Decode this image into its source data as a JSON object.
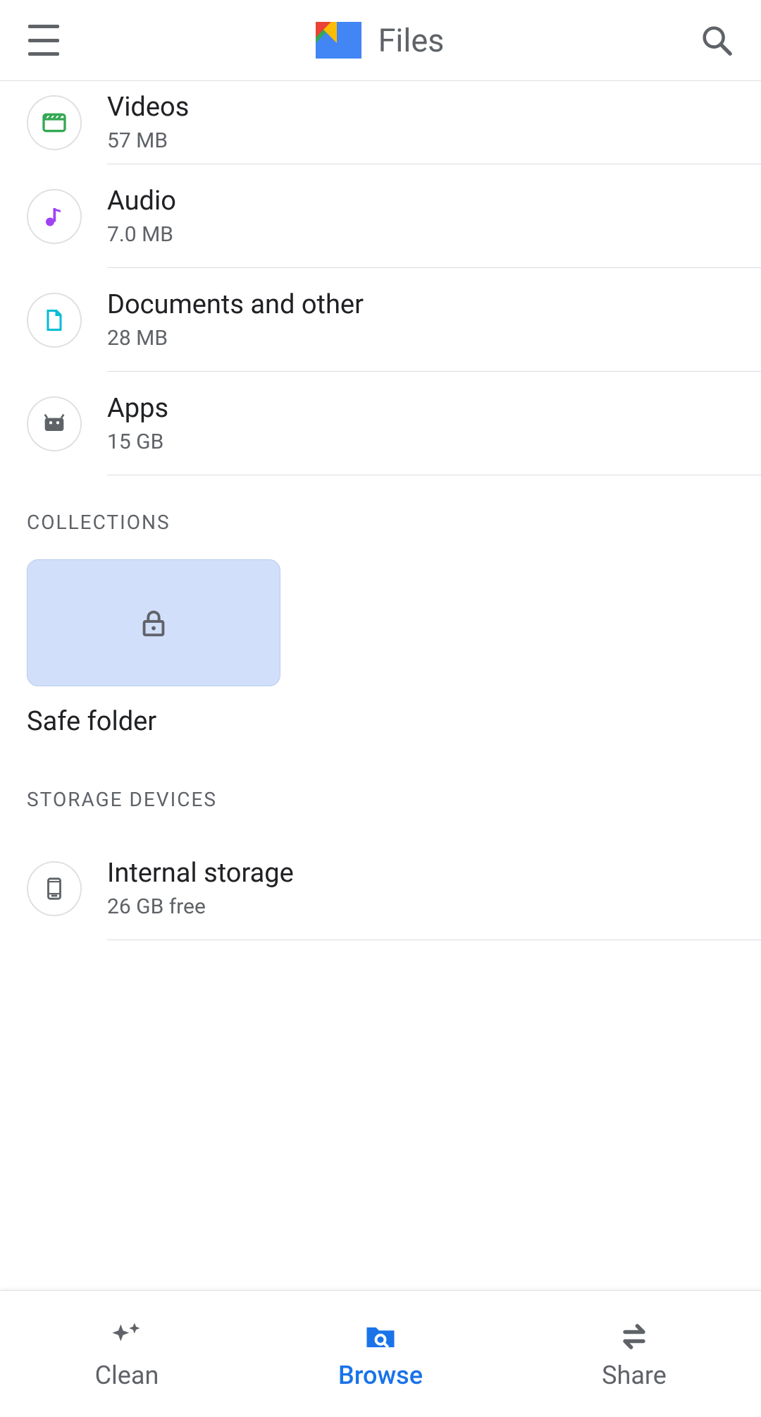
{
  "header": {
    "title": "Files"
  },
  "categories": [
    {
      "title": "Videos",
      "sub": "57 MB"
    },
    {
      "title": "Audio",
      "sub": "7.0 MB"
    },
    {
      "title": "Documents and other",
      "sub": "28 MB"
    },
    {
      "title": "Apps",
      "sub": "15 GB"
    }
  ],
  "sections": {
    "collections": "COLLECTIONS",
    "storage": "STORAGE DEVICES"
  },
  "collections": [
    {
      "label": "Safe folder"
    }
  ],
  "storage": [
    {
      "title": "Internal storage",
      "sub": "26 GB free"
    }
  ],
  "nav": {
    "clean": "Clean",
    "browse": "Browse",
    "share": "Share"
  }
}
